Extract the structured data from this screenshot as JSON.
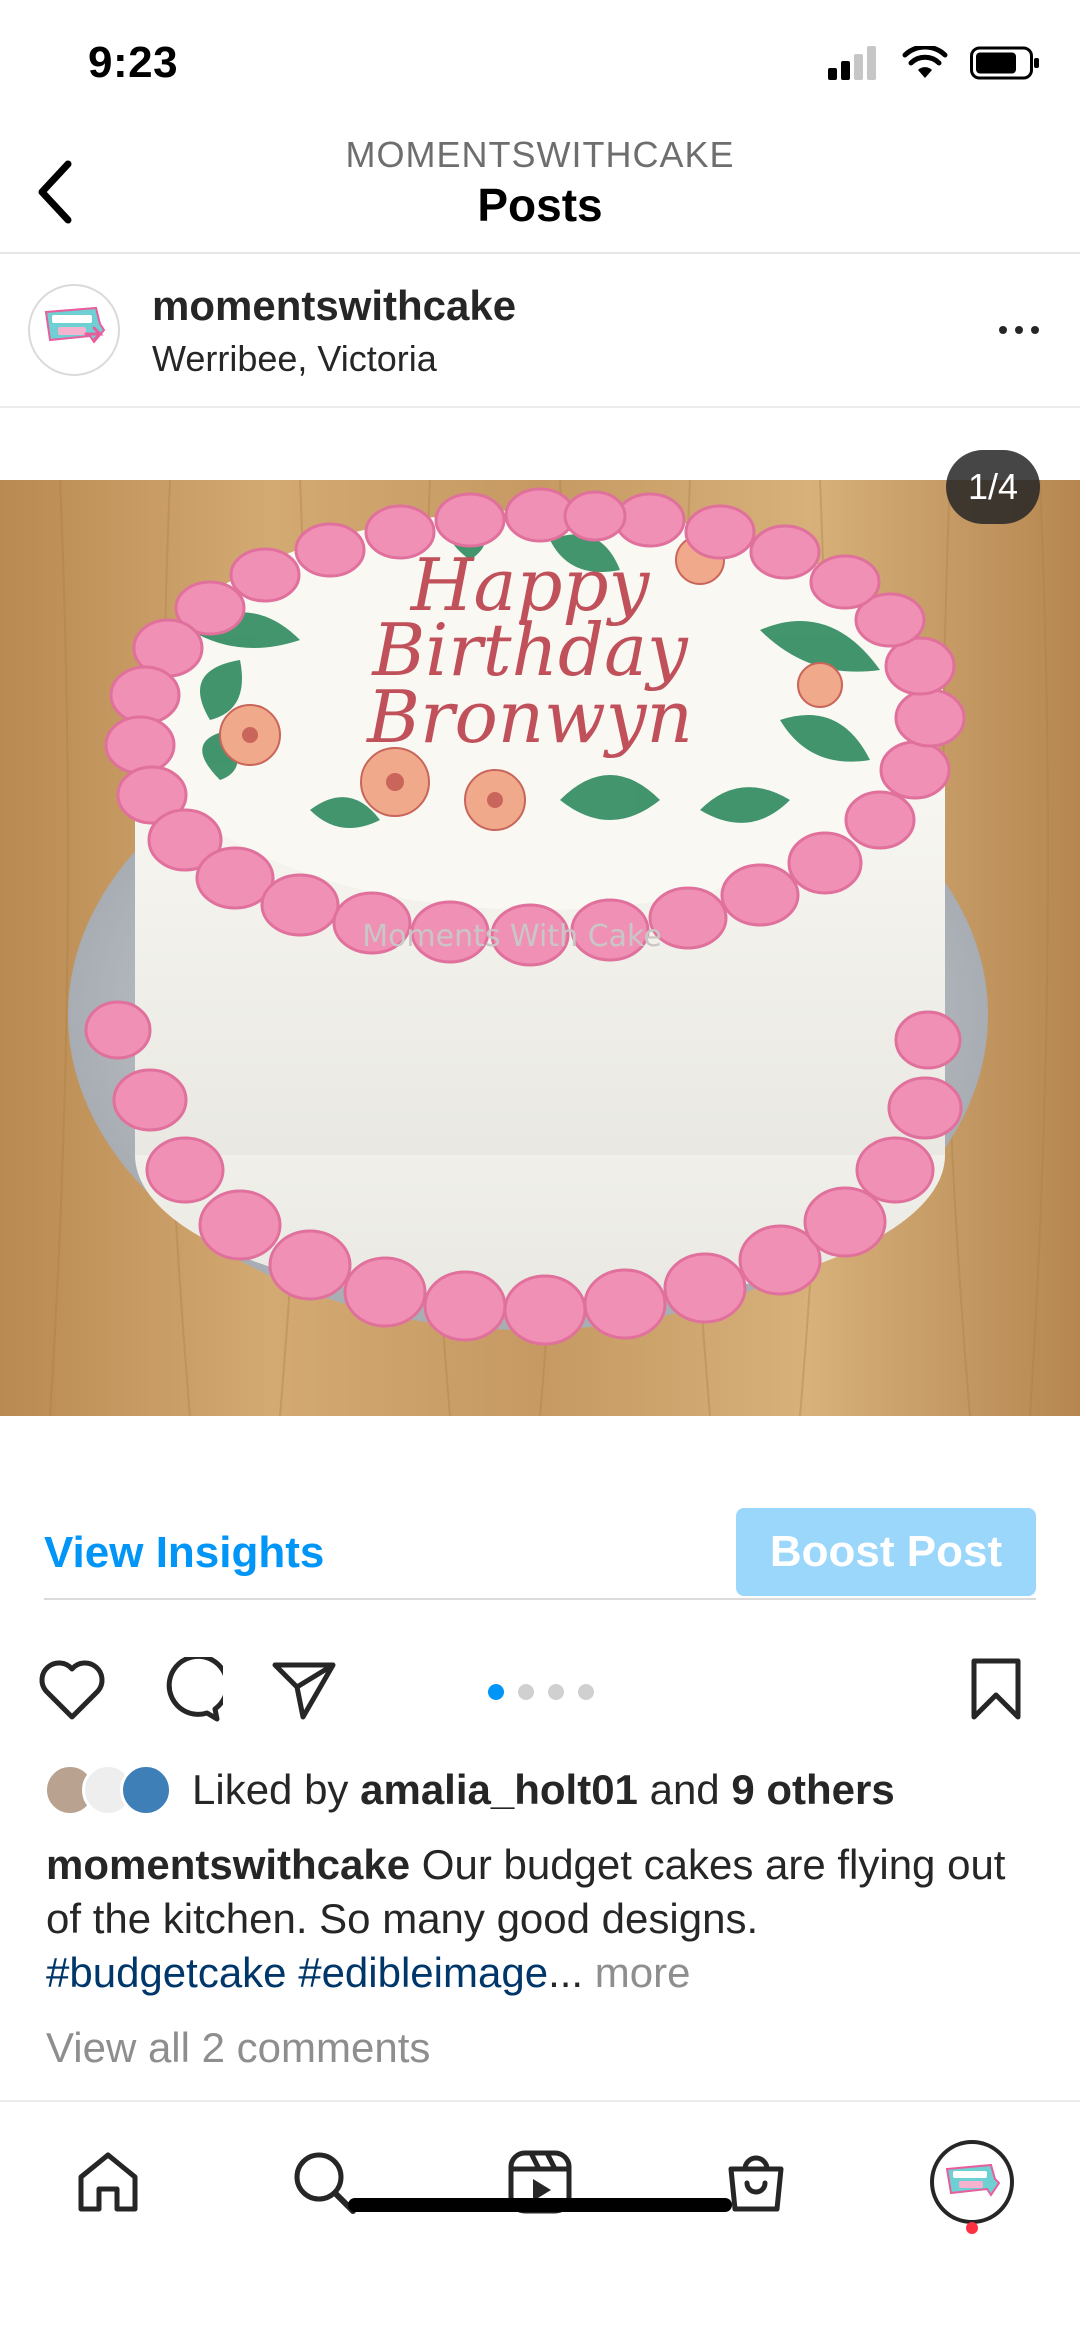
{
  "status_bar": {
    "time": "9:23"
  },
  "header": {
    "account": "MOMENTSWITHCAKE",
    "title": "Posts"
  },
  "post": {
    "author": "momentswithcake",
    "location": "Werribee, Victoria",
    "page_counter": "1/4",
    "image": {
      "cake_text_line1": "Happy",
      "cake_text_line2": "Birthday",
      "cake_text_line3": "Bronwyn",
      "watermark": "Moments With Cake"
    },
    "view_insights": "View Insights",
    "boost_post": "Boost Post",
    "carousel": {
      "count": 4,
      "active": 1
    },
    "likes": {
      "prefix": "Liked by ",
      "user": "amalia_holt01",
      "middle": " and ",
      "others": "9 others"
    },
    "caption": {
      "user": "momentswithcake",
      "text": " Our budget cakes are flying out of the kitchen.  So many good designs.",
      "tags": "#budgetcake #edibleimage",
      "ellipsis": "...",
      "more": " more"
    },
    "comments_link": "View all 2 comments"
  },
  "tab_bar": {
    "items": [
      "home-icon",
      "search-icon",
      "reels-icon",
      "shop-icon",
      "profile-avatar"
    ]
  },
  "colors": {
    "accent": "#0095f6",
    "boost_disabled": "#9bd6fb",
    "hashtag": "#00376b",
    "muted": "#8e8e8e",
    "frosting_pink": "#f08fb3",
    "notification": "#ff3040"
  }
}
